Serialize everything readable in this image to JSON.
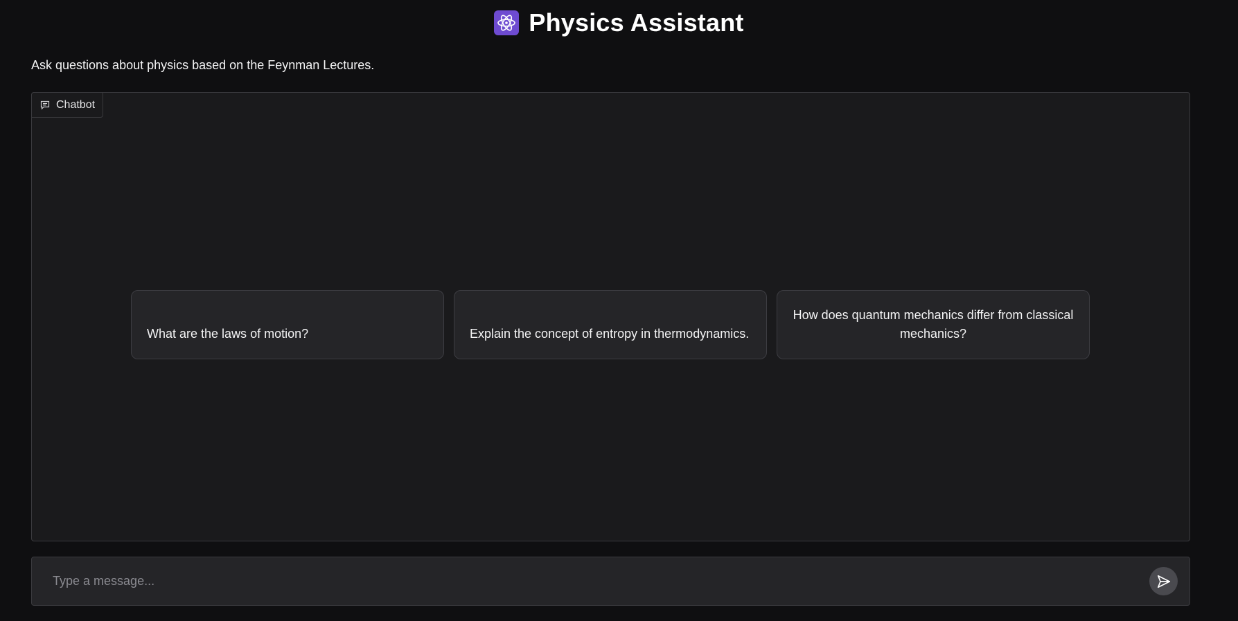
{
  "header": {
    "logo_icon": "atom-icon",
    "logo_color": "#6e4bd1",
    "title": "Physics Assistant"
  },
  "description": "Ask questions about physics based on the Feynman Lectures.",
  "chatbot": {
    "label": "Chatbot",
    "label_icon": "chat-icon",
    "examples": [
      "What are the laws of motion?",
      "Explain the concept of entropy in thermodynamics.",
      "How does quantum mechanics differ from classical mechanics?"
    ]
  },
  "input": {
    "placeholder": "Type a message...",
    "value": "",
    "send_icon": "send-icon"
  }
}
